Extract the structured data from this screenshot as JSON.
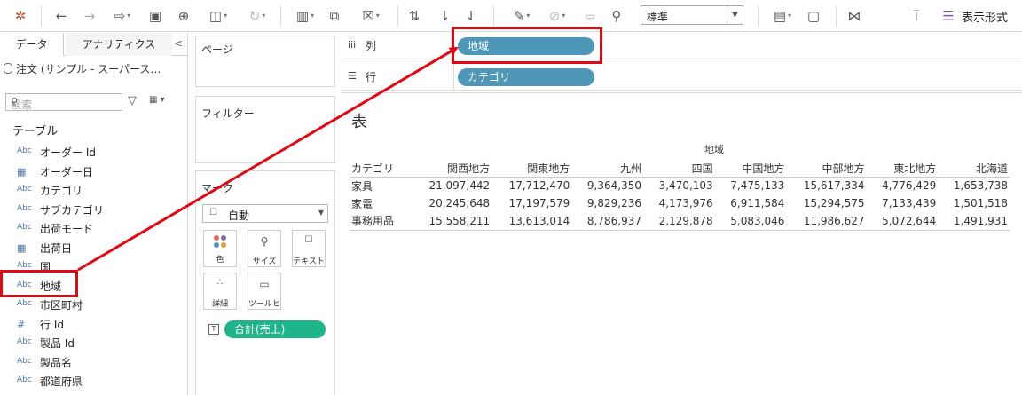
{
  "toolbar": {
    "standard_select": "標準",
    "showme_label": "表示形式"
  },
  "data_pane": {
    "tab_data": "データ",
    "tab_analytics": "アナリティクス",
    "collapse": "<",
    "datasource": "注文 (サンプル - スーパース…",
    "search_placeholder": "検索",
    "tables_heading": "テーブル",
    "fields": [
      {
        "type": "Abc",
        "name": "オーダー Id"
      },
      {
        "type": "date",
        "name": "オーダー日"
      },
      {
        "type": "Abc",
        "name": "カテゴリ"
      },
      {
        "type": "Abc",
        "name": "サブカテゴリ"
      },
      {
        "type": "Abc",
        "name": "出荷モード"
      },
      {
        "type": "date",
        "name": "出荷日"
      },
      {
        "type": "Abc",
        "name": "国"
      },
      {
        "type": "Abc",
        "name": "地域"
      },
      {
        "type": "Abc",
        "name": "市区町村"
      },
      {
        "type": "#",
        "name": "行 Id"
      },
      {
        "type": "Abc",
        "name": "製品 Id"
      },
      {
        "type": "Abc",
        "name": "製品名"
      },
      {
        "type": "Abc",
        "name": "都道府県"
      }
    ]
  },
  "shelves": {
    "pages_label": "ページ",
    "filters_label": "フィルター",
    "marks_label": "マーク",
    "mark_type": "自動",
    "mark_buttons": {
      "color": "色",
      "size": "サイズ",
      "text": "テキスト",
      "detail": "詳細",
      "tooltip": "ツールヒ…"
    },
    "mark_pill": "合計(売上)",
    "columns_label": "列",
    "rows_label": "行",
    "column_pill": "地域",
    "row_pill": "カテゴリ"
  },
  "view": {
    "title": "表",
    "column_header": "地域",
    "row_header": "カテゴリ",
    "columns": [
      "関西地方",
      "関東地方",
      "九州",
      "四国",
      "中国地方",
      "中部地方",
      "東北地方",
      "北海道"
    ],
    "rows": [
      {
        "category": "家具",
        "values": [
          "21,097,442",
          "17,712,470",
          "9,364,350",
          "3,470,103",
          "7,475,133",
          "15,617,334",
          "4,776,429",
          "1,653,738"
        ]
      },
      {
        "category": "家電",
        "values": [
          "20,245,648",
          "17,197,579",
          "9,829,236",
          "4,173,976",
          "6,911,584",
          "15,294,575",
          "7,133,439",
          "1,501,518"
        ]
      },
      {
        "category": "事務用品",
        "values": [
          "15,558,211",
          "13,613,014",
          "8,786,937",
          "2,129,878",
          "5,083,046",
          "11,986,627",
          "5,072,644",
          "1,491,931"
        ]
      }
    ]
  },
  "colors": {
    "pill_blue": "#4e97b8",
    "pill_green": "#1fb58a",
    "annotation_red": "#e30613"
  }
}
